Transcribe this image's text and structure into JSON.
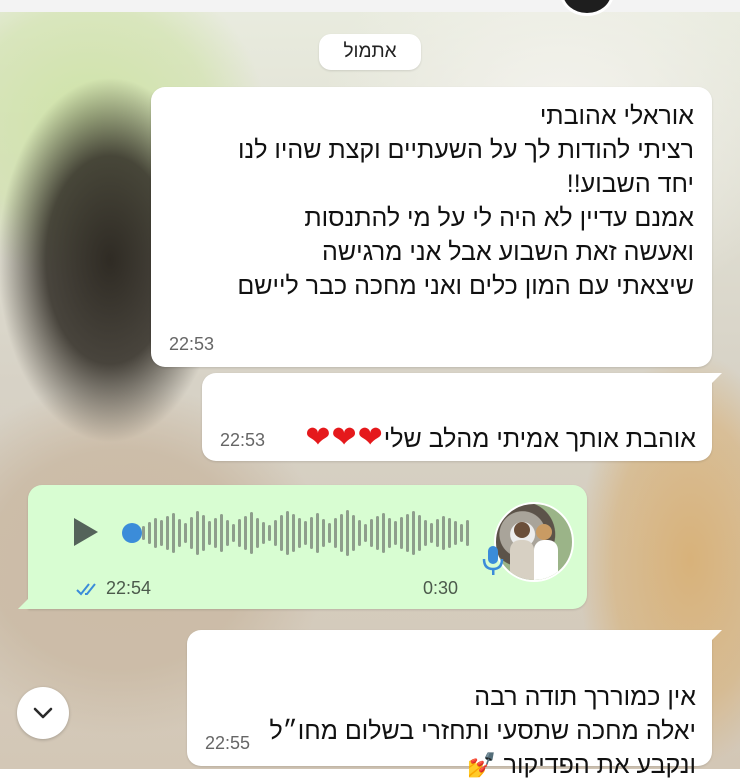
{
  "chat": {
    "date_separator": "אתמול",
    "messages": [
      {
        "direction": "incoming",
        "text": "אוראלי אהובתי\nרציתי להודות לך על השעתיים וקצת שהיו לנו\nיחד השבוע!!\nאמנם עדיין לא היה לי על מי להתנסות\nואעשה זאת השבוע אבל אני מרגישה\nשיצאתי עם המון כלים ואני מחכה כבר ליישם",
        "time": "22:53"
      },
      {
        "direction": "incoming",
        "text": "אוהבת אותך אמיתי מהלב שלי",
        "emoji": "❤❤❤",
        "time": "22:53"
      },
      {
        "direction": "outgoing",
        "type": "voice",
        "time": "22:54",
        "duration": "0:30",
        "read_status": "read",
        "progress": 0
      },
      {
        "direction": "incoming",
        "text": "אין כמוררך תודה רבה\nיאלה מחכה שתסעי ותחזרי בשלום מחו״ל\nונקבע את הפדיקור",
        "emoji": "💅",
        "time": "22:55"
      }
    ]
  },
  "icons": {
    "play": "play-icon",
    "mic": "mic-icon",
    "read_ticks": "double-check-icon",
    "scroll_down": "chevron-down-icon"
  },
  "colors": {
    "outgoing_bubble": "#d8fdd2",
    "incoming_bubble": "#ffffff",
    "read_ticks": "#3b8cd9",
    "hearts": "#e5191c",
    "waveform": "#8e9e8c",
    "progress_dot": "#3b8cd9"
  }
}
